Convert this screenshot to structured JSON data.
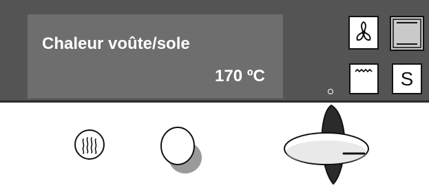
{
  "display": {
    "mode_name": "Chaleur voûte/sole",
    "temperature": "170 ºC"
  },
  "mode_buttons": [
    {
      "icon": "fan-icon",
      "selected": false
    },
    {
      "icon": "top-bottom-heat-icon",
      "selected": true
    },
    {
      "icon": "grill-icon",
      "selected": false
    },
    {
      "icon": "s-icon",
      "label": "S",
      "selected": false
    }
  ],
  "colors": {
    "panel": "#545454",
    "display": "#6e6e6e",
    "selected_button": "#c9c9c9"
  }
}
